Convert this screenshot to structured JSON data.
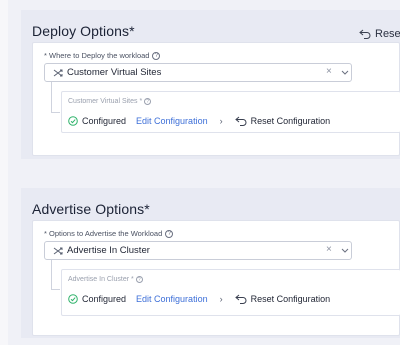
{
  "deploy": {
    "title": "Deploy Options",
    "required_mark": "*",
    "reset_all_label": "Reset a",
    "field_label": "* Where to Deploy the workload",
    "help_glyph": "?",
    "select_value": "Customer Virtual Sites",
    "clear_glyph": "×",
    "sub": {
      "label": "Customer Virtual Sites *",
      "status": "Configured",
      "edit_label": "Edit Configuration",
      "separator": "›",
      "reset_label": "Reset Configuration"
    }
  },
  "advertise": {
    "title": "Advertise Options",
    "required_mark": "*",
    "field_label": "* Options to Advertise the Workload",
    "help_glyph": "?",
    "select_value": "Advertise In Cluster",
    "clear_glyph": "×",
    "sub": {
      "label": "Advertise In Cluster *",
      "status": "Configured",
      "edit_label": "Edit Configuration",
      "separator": "›",
      "reset_label": "Reset Configuration"
    }
  },
  "colors": {
    "accent_link": "#3d6fd8",
    "success": "#2fb36b",
    "section_bg": "#e8eaf3"
  },
  "icons": {
    "select_glyph": "shuffle-icon",
    "reset": "reset-arrow-icon",
    "status": "check-circle-icon",
    "dropdown": "chevron-down-icon",
    "help": "help-circle-icon"
  }
}
